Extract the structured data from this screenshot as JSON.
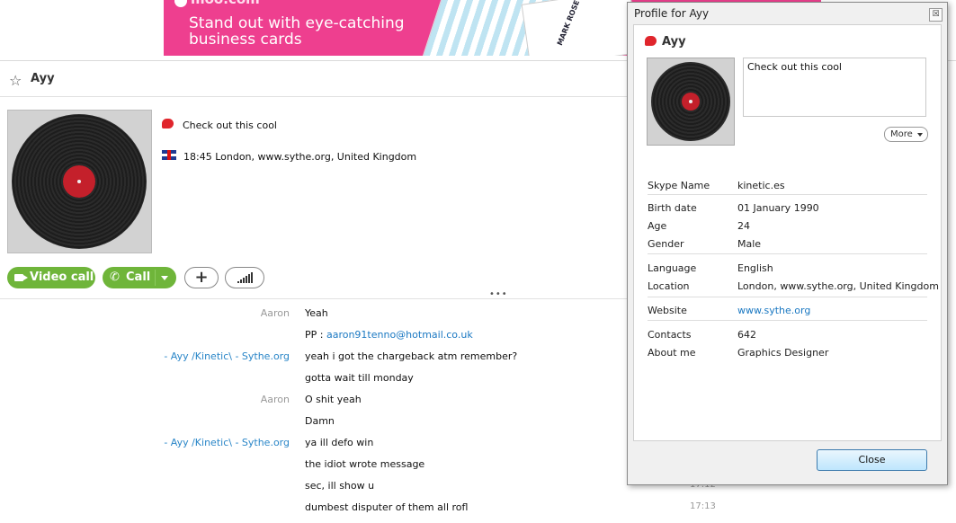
{
  "banner": {
    "brand": "moo.com",
    "headline_line1": "Stand out with eye-catching",
    "headline_line2": "business cards",
    "card_text": "MARK ROSE TIETJEN"
  },
  "contact": {
    "name": "Ayy",
    "mood": "Check out this cool",
    "location": "18:45 London, www.sythe.org, United Kingdom"
  },
  "actions": {
    "video_call": "Video call",
    "call": "Call",
    "add": "+"
  },
  "chat": {
    "messages": [
      {
        "sender": "Aaron",
        "text": "Yeah",
        "time": ""
      },
      {
        "sender": "",
        "text_prefix": "PP : ",
        "link": "aaron91tenno@hotmail.co.uk",
        "time": ""
      },
      {
        "sender": "- Ayy /Kinetic\\ - Sythe.org",
        "text": "yeah i got the chargeback atm remember?",
        "time": ""
      },
      {
        "sender": "",
        "text": "gotta wait till monday",
        "time": ""
      },
      {
        "sender": "Aaron",
        "text": "O shit yeah",
        "time": ""
      },
      {
        "sender": "",
        "text": "Damn",
        "time": ""
      },
      {
        "sender": "- Ayy /Kinetic\\ - Sythe.org",
        "text": "ya ill defo win",
        "time": ""
      },
      {
        "sender": "",
        "text": "the idiot wrote message",
        "time": ""
      },
      {
        "sender": "",
        "text": "sec, ill show u",
        "time": "17:12"
      },
      {
        "sender": "",
        "text": "dumbest disputer of them all rofl",
        "time": "17:13"
      }
    ]
  },
  "profile_dialog": {
    "title": "Profile for Ayy",
    "close_x": "☒",
    "name": "Ayy",
    "mood": "Check out this cool",
    "more_label": "More",
    "fields": {
      "skype_name": {
        "label": "Skype Name",
        "value": "kinetic.es"
      },
      "birth_date": {
        "label": "Birth date",
        "value": "01 January 1990"
      },
      "age": {
        "label": "Age",
        "value": "24"
      },
      "gender": {
        "label": "Gender",
        "value": "Male"
      },
      "language": {
        "label": "Language",
        "value": "English"
      },
      "location": {
        "label": "Location",
        "value": "London, www.sythe.org, United Kingdom"
      },
      "website": {
        "label": "Website",
        "value": "www.sythe.org"
      },
      "contacts": {
        "label": "Contacts",
        "value": "642"
      },
      "about_me": {
        "label": "About me",
        "value": "Graphics Designer"
      }
    },
    "close_button": "Close"
  },
  "colors": {
    "banner_pink": "#ee3f8f",
    "call_green": "#6fb53a",
    "skype_red": "#e0252c",
    "link_blue": "#1a78c2"
  }
}
